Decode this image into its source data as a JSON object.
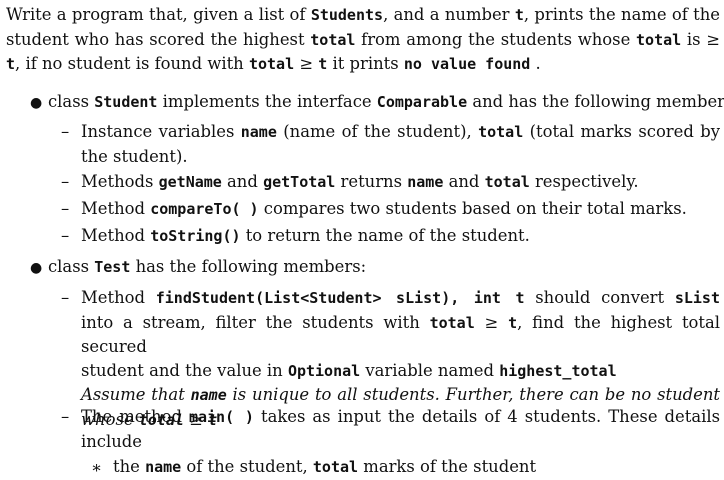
{
  "intro": {
    "line1": [
      "Write a program that, given a list of ",
      "Students",
      ", and a number ",
      "t",
      ", prints the name of the"
    ],
    "line2": [
      "student who has scored the highest ",
      "total",
      " from among the students whose ",
      "total",
      " is ≥"
    ],
    "line3": [
      "t",
      ", if no student is found with ",
      "total",
      " ≥ ",
      "t",
      " it prints ",
      "no value found",
      " ."
    ]
  },
  "bullet_student": {
    "line1": [
      "class ",
      "Student",
      " implements the interface ",
      "Comparable",
      " and has the following members:"
    ],
    "items": [
      {
        "line1": [
          "Instance variables ",
          "name",
          " (name of the student), ",
          "total",
          " (total marks scored by"
        ],
        "line2": [
          "the student)."
        ]
      },
      {
        "line1": [
          "Methods ",
          "getName",
          " and ",
          "getTotal",
          " returns ",
          "name",
          " and ",
          "total",
          " respectively."
        ]
      },
      {
        "line1": [
          "Method ",
          "compareTo( )",
          " compares two students based on their total marks."
        ]
      },
      {
        "line1": [
          "Method ",
          "toString()",
          " to return the name of the student."
        ]
      }
    ]
  },
  "bullet_test": {
    "line1": [
      "class ",
      "Test",
      " has the following members:"
    ],
    "find_item": {
      "line1": [
        "Method ",
        "findStudent(List<Student> sList), int t",
        " should convert ",
        "sList"
      ],
      "line2": [
        "into a stream, filter the students with ",
        "total",
        " ≥ ",
        "t",
        ", find the highest total secured"
      ],
      "line3": [
        "student and the value in ",
        "Optional",
        " variable named ",
        "highest_total"
      ],
      "line4": [
        "Assume that ",
        "name",
        " is unique to all students. Further, there can be no student"
      ],
      "line5": [
        "whose ",
        "total",
        " ≥ ",
        "t"
      ]
    },
    "main_item": {
      "line1": [
        "The method ",
        "main( )",
        " takes as input the details of 4 students.  These details"
      ],
      "line2": [
        "include"
      ],
      "sub": [
        "the ",
        "name",
        " of the student, ",
        "total",
        " marks of the student"
      ]
    }
  },
  "glyphs": {
    "bullet": "●",
    "dash": "–",
    "star": "∗"
  }
}
